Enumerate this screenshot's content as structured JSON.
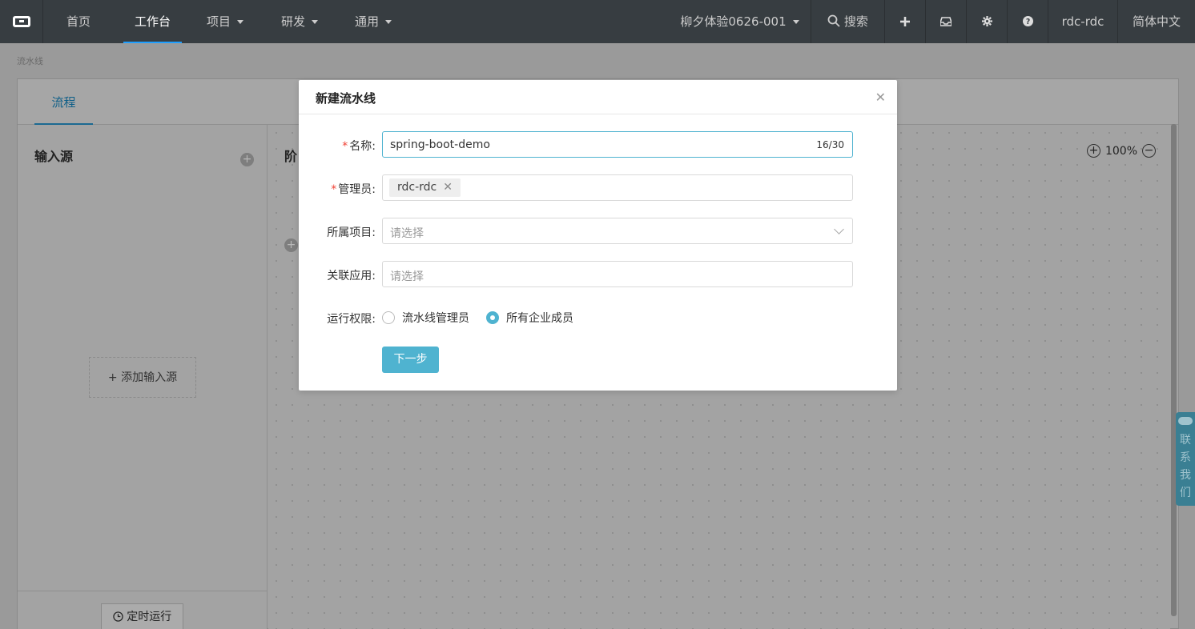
{
  "nav": {
    "items": [
      {
        "label": "首页"
      },
      {
        "label": "工作台"
      },
      {
        "label": "项目"
      },
      {
        "label": "研发"
      },
      {
        "label": "通用"
      }
    ],
    "org": "柳夕体验0626-001",
    "search": "搜索",
    "user": "rdc-rdc",
    "language": "简体中文"
  },
  "breadcrumb": "流水线",
  "tabs": [
    {
      "label": "流程"
    }
  ],
  "left": {
    "title": "输入源",
    "add_source": "+ 添加输入源",
    "timer_button": "定时运行"
  },
  "canvas": {
    "stage_title": "阶",
    "zoom": "100%"
  },
  "contact": [
    "联",
    "系",
    "我",
    "们"
  ],
  "modal": {
    "title": "新建流水线",
    "name_label": "名称:",
    "name_value": "spring-boot-demo",
    "name_count": "16/30",
    "admin_label": "管理员:",
    "admin_tag": "rdc-rdc",
    "project_label": "所属项目:",
    "project_placeholder": "请选择",
    "app_label": "关联应用:",
    "app_placeholder": "请选择",
    "perm_label": "运行权限:",
    "perm_options": [
      {
        "label": "流水线管理员",
        "selected": false
      },
      {
        "label": "所有企业成员",
        "selected": true
      }
    ],
    "next_button": "下一步"
  },
  "colors": {
    "accent": "#4fb3d0",
    "nav_bg": "#373d41",
    "required": "#f04134"
  }
}
